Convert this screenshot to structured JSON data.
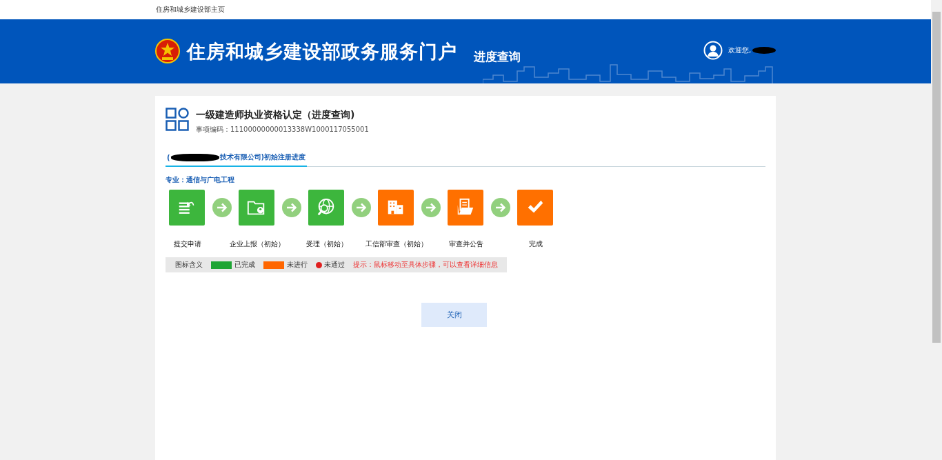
{
  "top_link": "住房和城乡建设部主页",
  "header": {
    "title": "住房和城乡建设部政务服务门户",
    "subtitle": "进度查询",
    "welcome": "欢迎您,"
  },
  "item": {
    "title": "一级建造师执业资格认定（进度查询)",
    "code_label": "事项编码：",
    "code": "11100000000013338W1000117055001"
  },
  "tabs": [
    {
      "prefix": "(",
      "label": "技术有限公司)初始注册进度",
      "selected": true
    }
  ],
  "major": {
    "label": "专业：",
    "value": "通信与广电工程"
  },
  "steps": [
    {
      "label": "提交申请",
      "done": true
    },
    {
      "label": "企业上报（初始）",
      "done": true
    },
    {
      "label": "受理（初始）",
      "done": true
    },
    {
      "label": "工信部审查（初始）",
      "done": false
    },
    {
      "label": "审查并公告",
      "done": false
    },
    {
      "label": "完成",
      "done": false
    }
  ],
  "legend": {
    "title": "图标含义",
    "items": [
      {
        "kind": "swatch",
        "label": "已完成",
        "color": "#1ea534"
      },
      {
        "kind": "swatch",
        "label": "未进行",
        "color": "#ff6600"
      },
      {
        "kind": "alert",
        "label": "未通过",
        "color": "#e02020"
      }
    ],
    "hint": "提示：鼠标移动至具体步骤，可以查看详细信息"
  },
  "close_button": "关闭"
}
